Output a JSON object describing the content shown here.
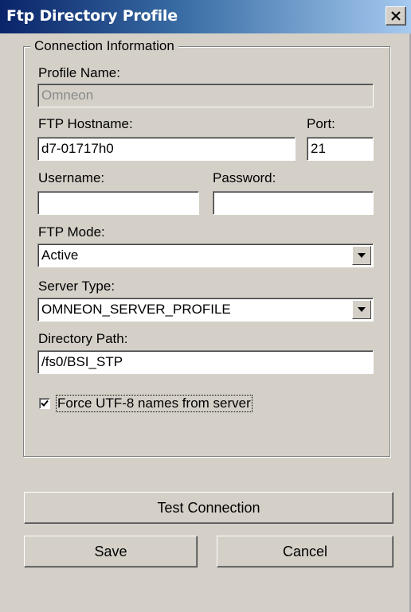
{
  "window": {
    "title": "Ftp Directory Profile",
    "close_icon": "close-icon"
  },
  "group": {
    "legend": "Connection Information"
  },
  "profile_name": {
    "label": "Profile Name:",
    "value": "Omneon"
  },
  "ftp_hostname": {
    "label": "FTP Hostname:",
    "value": "d7-01717h0"
  },
  "port": {
    "label": "Port:",
    "value": "21"
  },
  "username": {
    "label": "Username:",
    "value": ""
  },
  "password": {
    "label": "Password:",
    "value": ""
  },
  "ftp_mode": {
    "label": "FTP Mode:",
    "selected": "Active"
  },
  "server_type": {
    "label": "Server Type:",
    "selected": "OMNEON_SERVER_PROFILE"
  },
  "directory_path": {
    "label": "Directory Path:",
    "value": "/fs0/BSI_STP"
  },
  "force_utf8": {
    "label": "Force UTF-8 names from server",
    "checked": true
  },
  "buttons": {
    "test_connection": "Test Connection",
    "save": "Save",
    "cancel": "Cancel"
  }
}
